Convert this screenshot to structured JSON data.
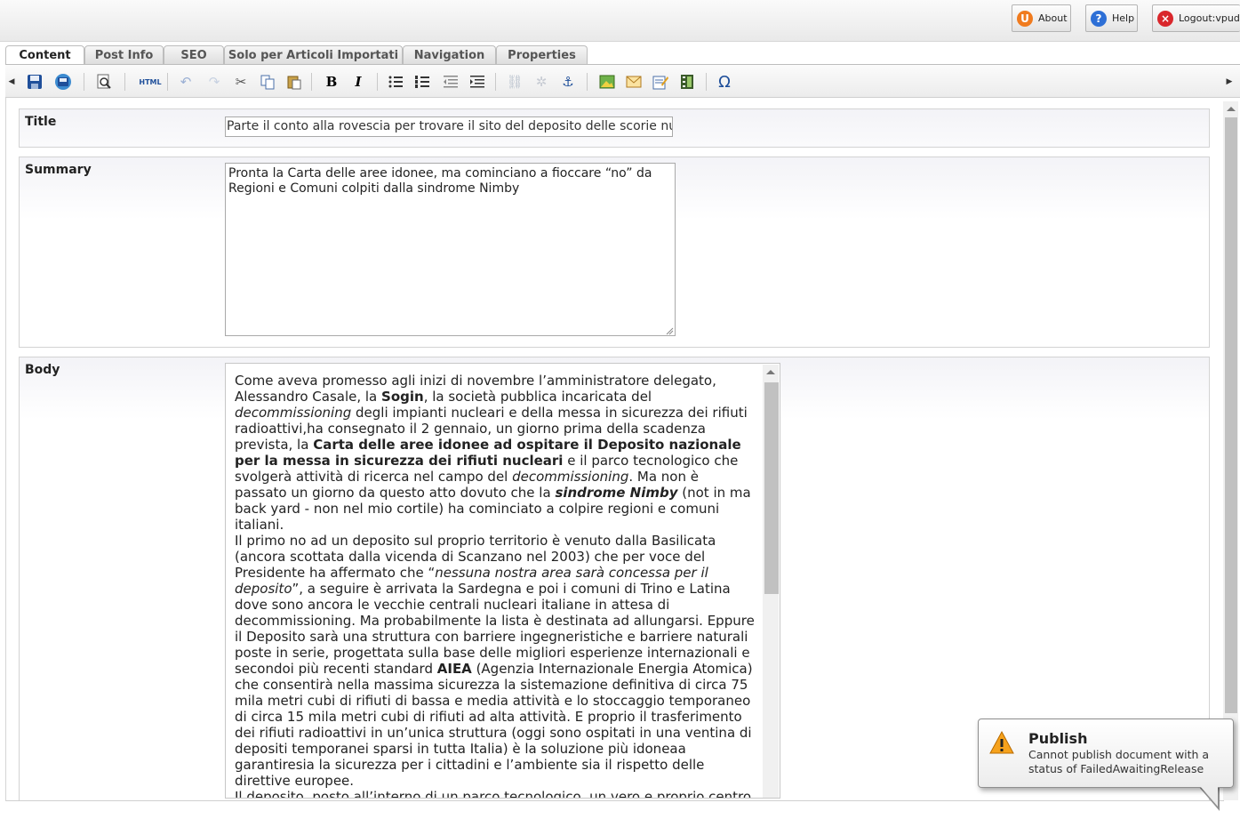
{
  "header": {
    "about_label": "About",
    "help_label": "Help",
    "logout_label": "Logout:vpudd"
  },
  "tabs": [
    {
      "label": "Content"
    },
    {
      "label": "Post Info"
    },
    {
      "label": "SEO"
    },
    {
      "label": "Solo per Articoli Importati"
    },
    {
      "label": "Navigation"
    },
    {
      "label": "Properties"
    }
  ],
  "toolbar": {
    "html_label": "HTML",
    "bold_label": "B",
    "italic_label": "I",
    "omega_label": "Ω"
  },
  "fields": {
    "title": {
      "label": "Title",
      "value": "Parte il conto alla rovescia per trovare il sito del deposito delle scorie nucleari"
    },
    "summary": {
      "label": "Summary",
      "value": "Pronta la Carta delle aree idonee, ma cominciano a fioccare “no” da Regioni e Comuni colpiti dalla sindrome Nimby"
    },
    "body": {
      "label": "Body",
      "p1": {
        "t1": "Come aveva promesso agli inizi di novembre l’amministratore delegato, Alessandro Casale, la ",
        "b1": "Sogin",
        "t2": ", la società pubblica incaricata del ",
        "i1": "decommissioning",
        "t3": " degli impianti nucleari e della messa in sicurezza dei rifiuti radioattivi,ha consegnato il 2 gennaio, un giorno prima della scadenza prevista, la ",
        "b2": "Carta delle aree idonee ad ospitare il Deposito nazionale per la messa in sicurezza dei rifiuti nucleari",
        "t4": " e il parco tecnologico che svolgerà attività di ricerca nel campo del ",
        "i2": "decommissioning",
        "t5": ". Ma non è passato un giorno da questo atto dovuto che la ",
        "bi1": "sindrome Nimby",
        "t6": " (not in ma back yard - non nel mio cortile) ha cominciato a colpire regioni e comuni italiani."
      },
      "p2": {
        "t1": "Il primo no ad un deposito sul proprio territorio è venuto dalla Basilicata (ancora scottata dalla vicenda di Scanzano nel 2003) che per voce del Presidente ha affermato che “",
        "i1": "nessuna nostra area sarà concessa per il deposito",
        "t2": "”, a seguire è arrivata la Sardegna e poi i comuni di Trino e Latina dove sono ancora le vecchie centrali nucleari italiane in attesa di decommissioning. Ma probabilmente la lista è destinata ad allungarsi. Eppure il Deposito sarà una struttura con barriere ingegneristiche e barriere naturali poste in serie, progettata sulla base delle migliori esperienze internazionali e secondoi più recenti standard ",
        "b1": "AIEA",
        "t3": " (Agenzia Internazionale Energia Atomica) che consentirà nella massima sicurezza la sistemazione definitiva di circa 75 mila metri cubi di rifiuti di bassa e media attività e lo stoccaggio temporaneo di circa 15 mila metri cubi di rifiuti ad alta attività. E proprio il trasferimento dei rifiuti radioattivi in un’unica struttura (oggi sono ospitati in una ventina di depositi temporanei sparsi in tutta Italia) è la soluzione più idoneaa garantiresia la sicurezza per i cittadini e l’ambiente sia il rispetto delle direttive europee."
      },
      "p3": "Il deposito, posto all’interno di un parco tecnologico, un vero e proprio centro"
    }
  },
  "notification": {
    "title": "Publish",
    "message": "Cannot publish document with a status of FailedAwaitingRelease"
  },
  "colors": {
    "accent_orange": "#f07b1e",
    "help_blue": "#2d6fd6",
    "logout_red": "#d9262b",
    "warning_yellow": "#f6a21c"
  }
}
